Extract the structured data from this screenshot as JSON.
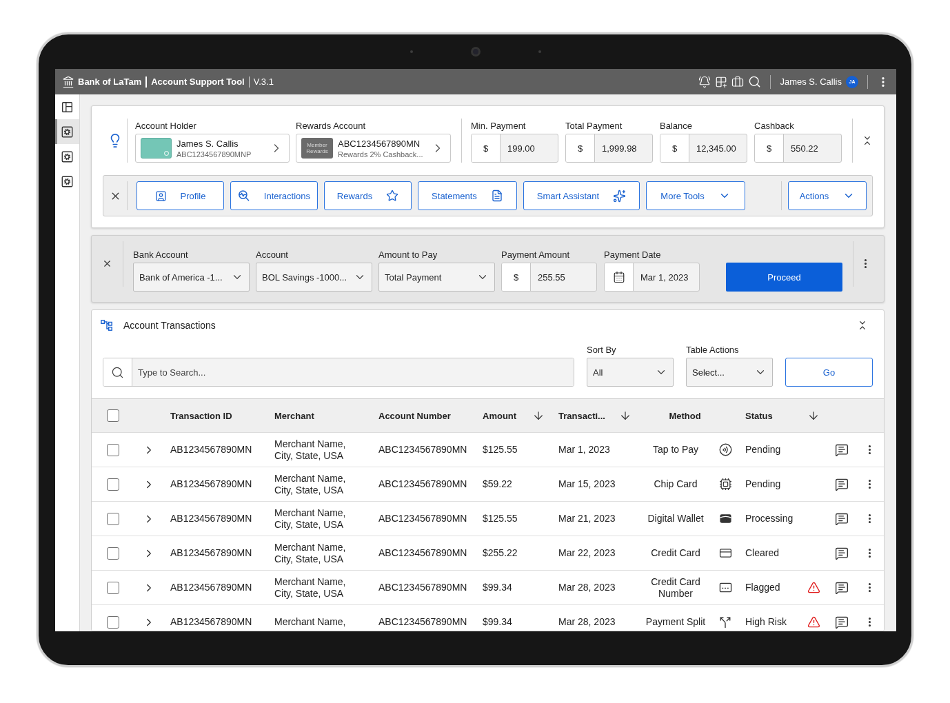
{
  "app_bar": {
    "bank_name": "Bank of LaTam",
    "tool_name": "Account Support Tool",
    "version": "V.3.1",
    "user_name": "James S. Callis",
    "user_initials": "JA"
  },
  "sidebar": {
    "items": [
      {
        "kind": "layout",
        "selected": false
      },
      {
        "kind": "settings",
        "selected": true
      },
      {
        "kind": "settings",
        "selected": false
      },
      {
        "kind": "settings",
        "selected": false
      }
    ]
  },
  "account_summary": {
    "account_holder": {
      "label": "Account Holder",
      "name": "James S. Callis",
      "number": "ABC1234567890MNP"
    },
    "rewards_account": {
      "label": "Rewards Account",
      "badge": "Member Rewards",
      "number": "ABC1234567890MN",
      "description": "Rewards 2% Cashback..."
    },
    "amounts": [
      {
        "label": "Min. Payment",
        "currency": "$",
        "value": "199.00"
      },
      {
        "label": "Total Payment",
        "currency": "$",
        "value": "1,999.98"
      },
      {
        "label": "Balance",
        "currency": "$",
        "value": "12,345.00"
      },
      {
        "label": "Cashback",
        "currency": "$",
        "value": "550.22"
      }
    ],
    "tool_buttons": [
      {
        "label": "Profile"
      },
      {
        "label": "Interactions"
      },
      {
        "label": "Rewards"
      },
      {
        "label": "Statements"
      },
      {
        "label": "Smart Assistant"
      },
      {
        "label": "More Tools"
      }
    ],
    "actions_button": {
      "label": "Actions"
    }
  },
  "payment": {
    "fields": [
      {
        "kind": "select",
        "label": "Bank Account",
        "value": "Bank of America -1..."
      },
      {
        "kind": "select",
        "label": "Account",
        "value": "BOL Savings -1000..."
      },
      {
        "kind": "select",
        "label": "Amount to Pay",
        "value": "Total Payment"
      },
      {
        "kind": "amount",
        "label": "Payment Amount",
        "currency": "$",
        "value": "255.55"
      },
      {
        "kind": "date",
        "label": "Payment Date",
        "value": "Mar 1, 2023"
      }
    ],
    "proceed_button": {
      "label": "Proceed"
    }
  },
  "transactions": {
    "title": "Account Transactions",
    "search": {
      "placeholder": "Type to Search..."
    },
    "sort_by": {
      "label": "Sort By",
      "value": "All"
    },
    "table_actions": {
      "label": "Table Actions",
      "placeholder": "Select..."
    },
    "go_button": {
      "label": "Go"
    },
    "table": {
      "select_all_checked": false,
      "columns": [
        {
          "label": "Transaction ID",
          "sortable": false
        },
        {
          "label": "Merchant",
          "sortable": false
        },
        {
          "label": "Account Number",
          "sortable": false
        },
        {
          "label": "Amount",
          "sortable": true
        },
        {
          "label": "Transacti...",
          "sortable": true
        },
        {
          "label": "Method",
          "sortable": false
        },
        {
          "label": "Status",
          "sortable": true
        }
      ],
      "rows": [
        {
          "kind": "tap",
          "checked": false,
          "expanded": false,
          "transaction_id": "AB1234567890MN",
          "merchant": "Merchant Name, City, State, USA",
          "account_number": "ABC1234567890MN",
          "amount": "$125.55",
          "date": "Mar 1, 2023",
          "method": "Tap to Pay",
          "status": "Pending",
          "alert": false
        },
        {
          "kind": "chip",
          "checked": false,
          "expanded": false,
          "transaction_id": "AB1234567890MN",
          "merchant": "Merchant Name, City, State, USA",
          "account_number": "ABC1234567890MN",
          "amount": "$59.22",
          "date": "Mar 15, 2023",
          "method": "Chip Card",
          "status": "Pending",
          "alert": false
        },
        {
          "kind": "wallet",
          "checked": false,
          "expanded": false,
          "transaction_id": "AB1234567890MN",
          "merchant": "Merchant Name, City, State, USA",
          "account_number": "ABC1234567890MN",
          "amount": "$125.55",
          "date": "Mar 21, 2023",
          "method": "Digital Wallet",
          "status": "Processing",
          "alert": false
        },
        {
          "kind": "card",
          "checked": false,
          "expanded": false,
          "transaction_id": "AB1234567890MN",
          "merchant": "Merchant Name, City, State, USA",
          "account_number": "ABC1234567890MN",
          "amount": "$255.22",
          "date": "Mar 22, 2023",
          "method": "Credit Card",
          "status": "Cleared",
          "alert": false
        },
        {
          "kind": "number",
          "checked": false,
          "expanded": false,
          "transaction_id": "AB1234567890MN",
          "merchant": "Merchant Name, City, State, USA",
          "account_number": "ABC1234567890MN",
          "amount": "$99.34",
          "date": "Mar 28, 2023",
          "method": "Credit Card Number",
          "status": "Flagged",
          "alert": true
        },
        {
          "kind": "split",
          "checked": false,
          "expanded": false,
          "transaction_id": "AB1234567890MN",
          "merchant": "Merchant Name,",
          "account_number": "ABC1234567890MN",
          "amount": "$99.34",
          "date": "Mar 28, 2023",
          "method": "Payment Split",
          "status": "High Risk",
          "alert": true
        }
      ]
    }
  }
}
